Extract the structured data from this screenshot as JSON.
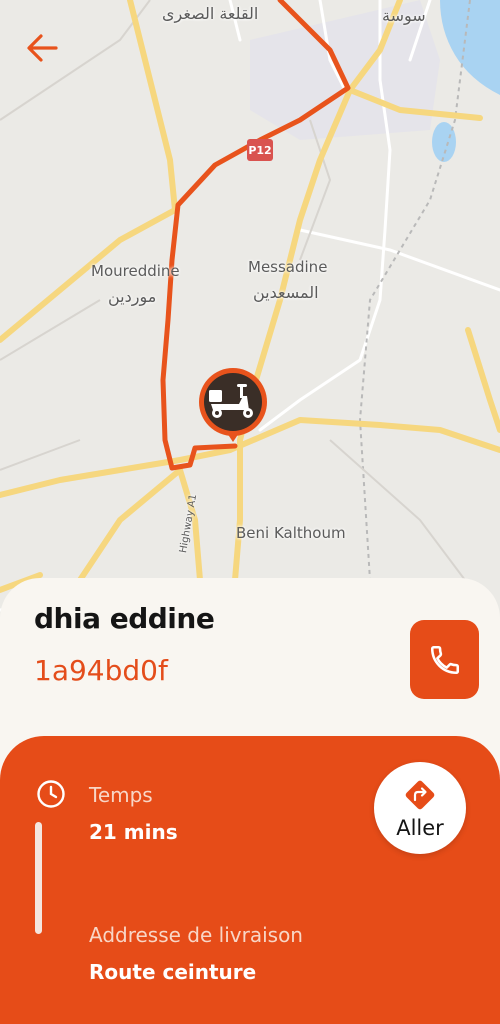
{
  "map": {
    "labels": [
      {
        "id": "kalaa-seghira-ar",
        "text": "القلعة الصغرى"
      },
      {
        "id": "sousse-ar",
        "text": "سوسة"
      },
      {
        "id": "moureddine-fr",
        "text": "Moureddine"
      },
      {
        "id": "moureddine-ar",
        "text": "موردين"
      },
      {
        "id": "messadine-fr",
        "text": "Messadine"
      },
      {
        "id": "messadine-ar",
        "text": "المسعدين"
      },
      {
        "id": "beni-kalthoum-fr",
        "text": "Beni Kalthoum"
      },
      {
        "id": "highway-a1",
        "text": "Highway A1"
      }
    ],
    "road_badge": "P12",
    "route_color": "#e8531c"
  },
  "header": {
    "back_icon": "arrow-left-icon"
  },
  "marker": {
    "icon": "scooter-icon"
  },
  "driver": {
    "name": "dhia eddine",
    "order_id": "1a94bd0f",
    "call_icon": "phone-icon"
  },
  "trip": {
    "time_label": "Temps",
    "time_value": "21 mins",
    "address_label": "Addresse de livraison",
    "address_value": "Route ceinture",
    "go_label": "Aller",
    "go_icon": "directions-icon",
    "time_icon": "clock-icon"
  },
  "colors": {
    "accent": "#e64c18",
    "sheet_bg": "#f9f6f1"
  }
}
